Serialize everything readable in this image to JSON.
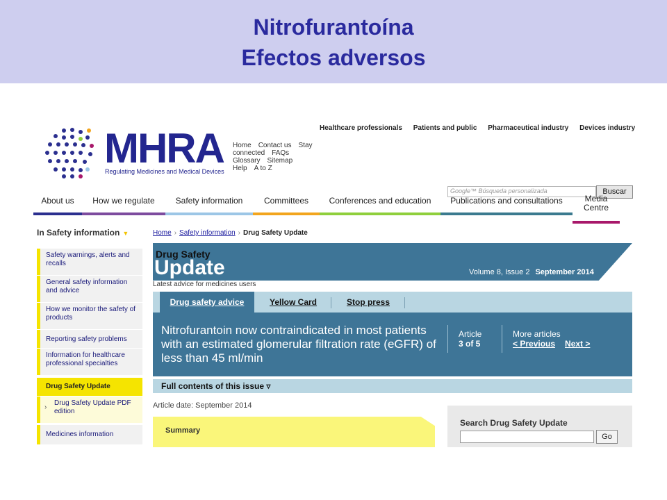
{
  "slide": {
    "title_line1": "Nitrofurantoína",
    "title_line2": "Efectos adversos"
  },
  "logo": {
    "name": "MHRA",
    "subtitle": "Regulating Medicines and Medical Devices"
  },
  "utility_links": [
    [
      "Home",
      "Contact us",
      "Stay"
    ],
    [
      "connected",
      "FAQs"
    ],
    [
      "Glossary",
      "Sitemap"
    ],
    [
      "Help",
      "A to Z"
    ]
  ],
  "top_nav": [
    "Healthcare professionals",
    "Patients and public",
    "Pharmaceutical industry",
    "Devices industry"
  ],
  "search": {
    "placeholder": "Google™ Búsqueda personalizada",
    "button": "Buscar"
  },
  "main_nav": [
    {
      "label": "About us",
      "color": "#2b2f8f"
    },
    {
      "label": "How we regulate",
      "color": "#7d4b9e"
    },
    {
      "label": "Safety information",
      "color": "#9cc6e6"
    },
    {
      "label": "Committees",
      "color": "#f2a51e"
    },
    {
      "label": "Conferences and education",
      "color": "#8fcf3c"
    },
    {
      "label": "Publications and consultations",
      "color": "#3b7a8f"
    },
    {
      "label": "Media Centre",
      "color": "#a8186a"
    }
  ],
  "sidebar": {
    "title": "In Safety information",
    "items": [
      "Safety warnings, alerts and recalls",
      "General safety information and advice",
      "How we monitor the safety of products",
      "Reporting safety problems",
      "Information for healthcare professional specialties",
      "Drug Safety Update",
      "Drug Safety Update PDF edition",
      "Medicines information"
    ]
  },
  "breadcrumb": [
    "Home",
    "Safety information",
    "Drug Safety Update"
  ],
  "dsu": {
    "title_small": "Drug Safety",
    "title_large": "Update",
    "volume": "Volume 8, Issue 2",
    "date": "September 2014",
    "tagline": "Latest advice for medicines users"
  },
  "tabs": [
    "Drug safety advice",
    "Yellow Card",
    "Stop press"
  ],
  "article": {
    "title": "Nitrofurantoin now contraindicated in most patients with an estimated glomerular filtration rate (eGFR) of less than 45 ml/min",
    "num_label": "Article",
    "num": "3 of 5",
    "more_label": "More articles",
    "prev": "< Previous",
    "next": "Next >"
  },
  "contents_bar": "Full contents of this issue ▿",
  "article_date": "Article date: September 2014",
  "summary_label": "Summary",
  "search_dsu": {
    "label": "Search Drug Safety Update",
    "button": "Go"
  }
}
